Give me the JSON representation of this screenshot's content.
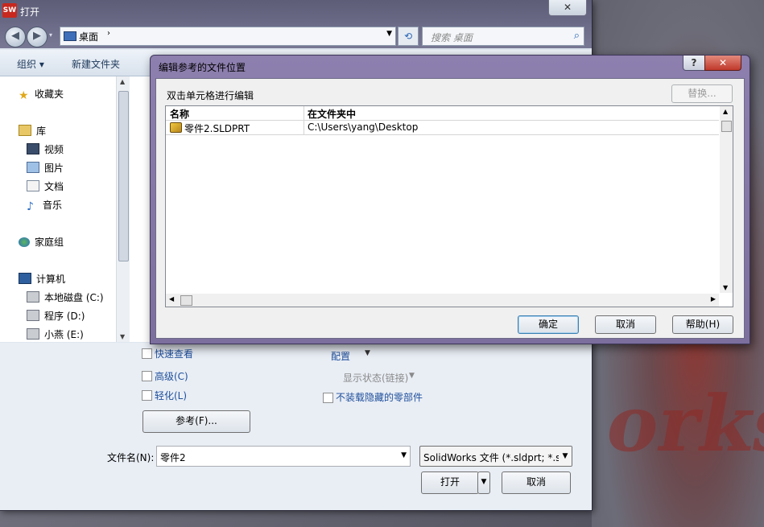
{
  "window": {
    "title": "打开",
    "app_icon_text": "SW",
    "close_symbol": "✕"
  },
  "nav": {
    "back_symbol": "◀",
    "forward_symbol": "▶",
    "address": "桌面",
    "address_arrow": "›",
    "refresh_symbol": "⟲",
    "search_placeholder": "搜索 桌面",
    "search_icon": "search-icon"
  },
  "command_bar": {
    "organize": "组织 ▾",
    "new_folder": "新建文件夹"
  },
  "sidebar": {
    "items": [
      {
        "label": "收藏夹",
        "icon": "star-icon"
      },
      {
        "label": "库",
        "icon": "library-icon"
      },
      {
        "label": "视频",
        "icon": "video-icon"
      },
      {
        "label": "图片",
        "icon": "picture-icon"
      },
      {
        "label": "文档",
        "icon": "document-icon"
      },
      {
        "label": "音乐",
        "icon": "music-icon"
      },
      {
        "label": "家庭组",
        "icon": "homegroup-icon"
      },
      {
        "label": "计算机",
        "icon": "computer-icon"
      },
      {
        "label": "本地磁盘 (C:)",
        "icon": "drive-icon"
      },
      {
        "label": "程序 (D:)",
        "icon": "drive-icon"
      },
      {
        "label": "小燕 (E:)",
        "icon": "drive-icon"
      }
    ]
  },
  "options": {
    "quick_view": "快速查看",
    "advanced": "高级(C)",
    "lightweight": "轻化(L)",
    "configuration": "配置",
    "display_state": "显示状态(链接)",
    "no_hidden_parts": "不装载隐藏的零部件",
    "references_button": "参考(F)...",
    "filename_label": "文件名(N):",
    "filename_value": "零件2",
    "filetype_value": "SolidWorks 文件 (*.sldprt; *.s",
    "open_button": "打开",
    "cancel_button": "取消"
  },
  "ref_dialog": {
    "title": "编辑参考的文件位置",
    "help_symbol": "?",
    "close_symbol": "✕",
    "hint": "双击单元格进行编辑",
    "replace_button": "替换...",
    "columns": [
      "名称",
      "在文件夹中"
    ],
    "rows": [
      {
        "name": "零件2.SLDPRT",
        "folder": "C:\\Users\\yang\\Desktop"
      }
    ],
    "ok_button": "确定",
    "cancel_button": "取消",
    "help_button": "帮助(H)"
  },
  "colors": {
    "link_blue": "#1f4f9c",
    "title_bar": "#6a6a86",
    "ref_frame": "#8d7fae",
    "close_red": "#c0392b"
  }
}
